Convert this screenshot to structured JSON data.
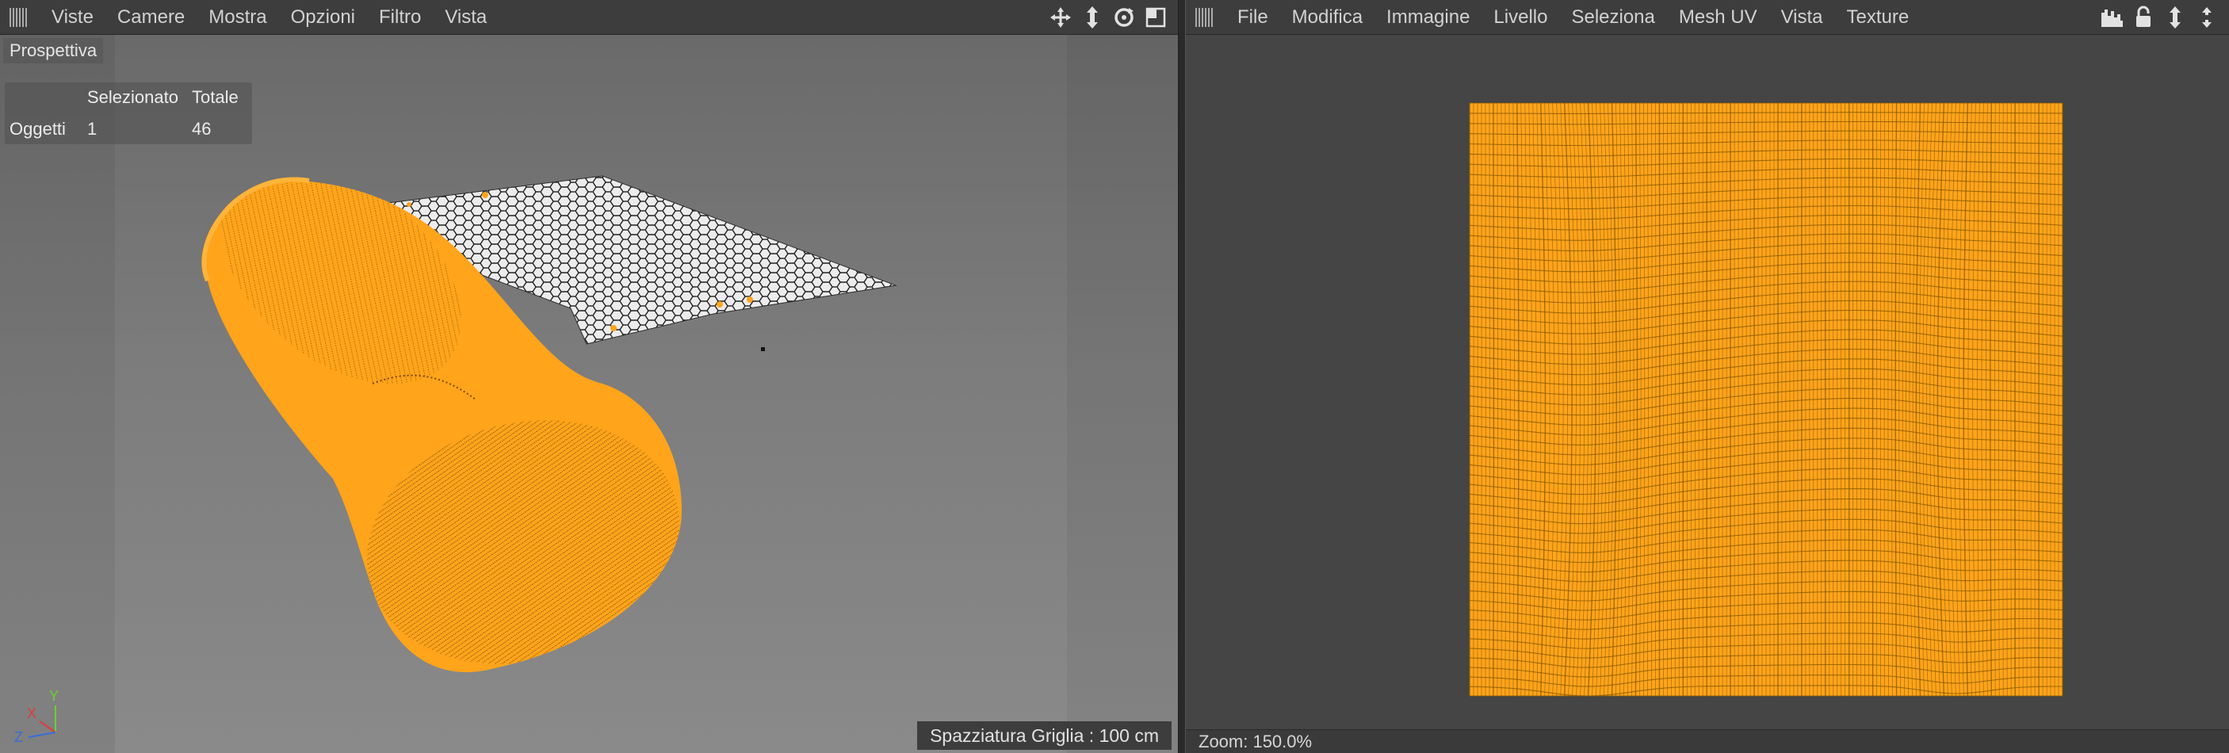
{
  "viewport_panel": {
    "menu": [
      "Viste",
      "Camere",
      "Mostra",
      "Opzioni",
      "Filtro",
      "Vista"
    ],
    "toolbar_icons": [
      "move-view-icon",
      "pan-view-icon",
      "rotate-view-icon",
      "maximize-view-icon"
    ],
    "view_label": "Prospettiva",
    "hud": {
      "header_selected": "Selezionato",
      "header_total": "Totale",
      "row_label": "Oggetti",
      "selected": "1",
      "total": "46"
    },
    "axis": {
      "x": "X",
      "y": "Y",
      "z": "Z"
    },
    "status": "Spazziatura Griglia : 100 cm"
  },
  "uv_panel": {
    "menu": [
      "File",
      "Modifica",
      "Immagine",
      "Livello",
      "Seleziona",
      "Mesh UV",
      "Vista",
      "Texture"
    ],
    "toolbar_icons": [
      "histogram-icon",
      "lock-icon",
      "pan-view-icon",
      "zoom-view-icon"
    ],
    "zoom": "Zoom: 150.0%"
  },
  "colors": {
    "accent_orange": "#ffa41b",
    "mesh_line_dark": "#8a5a00",
    "viewport_bg": "#7a7a7a",
    "uv_bg": "#454545"
  }
}
